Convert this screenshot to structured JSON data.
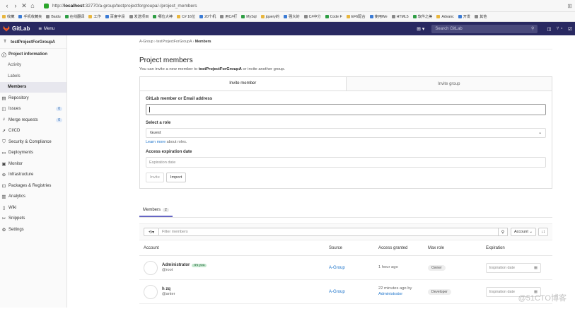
{
  "browser": {
    "url_prefix": "http://",
    "url_host": "localhost",
    "url_rest": ":32770/a-group/testprojectforgroupa/-/project_members",
    "bookmarks": [
      "收藏",
      "手机收藏夹",
      "Baidu",
      "在线翻译",
      "工作",
      "百度字段",
      "发送项目",
      "哪位大神",
      "C# 16位",
      "20个机",
      "用C#打",
      "MySql",
      "jquery的",
      "强大的",
      "C#中分",
      "Code F",
      "EF6配合",
      "使用We",
      "HTML5",
      "软件之美",
      "Advanc",
      "开发",
      "其他"
    ]
  },
  "header": {
    "brand": "GitLab",
    "menu_label": "Menu",
    "search_placeholder": "Search GitLab"
  },
  "sidebar": {
    "project_initial": "T",
    "project_name": "testProjectForGroupA",
    "items": [
      {
        "label": "Project information",
        "icon": "info-icon"
      },
      {
        "label": "Activity"
      },
      {
        "label": "Labels"
      },
      {
        "label": "Members"
      },
      {
        "label": "Repository",
        "icon": "doc-icon"
      },
      {
        "label": "Issues",
        "icon": "issues-icon",
        "count": "0"
      },
      {
        "label": "Merge requests",
        "icon": "merge-icon",
        "count": "0"
      },
      {
        "label": "CI/CD",
        "icon": "rocket-icon"
      },
      {
        "label": "Security & Compliance",
        "icon": "shield-icon"
      },
      {
        "label": "Deployments",
        "icon": "deploy-icon"
      },
      {
        "label": "Monitor",
        "icon": "monitor-icon"
      },
      {
        "label": "Infrastructure",
        "icon": "infra-icon"
      },
      {
        "label": "Packages & Registries",
        "icon": "package-icon"
      },
      {
        "label": "Analytics",
        "icon": "chart-icon"
      },
      {
        "label": "Wiki",
        "icon": "book-icon"
      },
      {
        "label": "Snippets",
        "icon": "scissors-icon"
      },
      {
        "label": "Settings",
        "icon": "gear-icon"
      }
    ]
  },
  "breadcrumb": [
    "A-Group",
    "testProjectForGroupA",
    "Members"
  ],
  "page": {
    "title": "Project members",
    "lead_prefix": "You can invite a new member to",
    "lead_project": "testProjectForGroupA",
    "lead_suffix": "or invite another group."
  },
  "invite": {
    "tab_member": "Invite member",
    "tab_group": "Invite group",
    "member_label": "GitLab member or Email address",
    "role_label": "Select a role",
    "role_value": "Guest",
    "learn_more": "Learn more",
    "about_roles": "about roles.",
    "expiration_label": "Access expiration date",
    "expiration_placeholder": "Expiration date",
    "invite_button": "Invite",
    "import_button": "Import"
  },
  "members": {
    "tab_label": "Members",
    "tab_count": "2",
    "filter_placeholder": "Filter members",
    "sort_label": "Account",
    "columns": [
      "Account",
      "Source",
      "Access granted",
      "Max role",
      "Expiration"
    ],
    "rows": [
      {
        "name": "Administrator",
        "badge": "It's you",
        "handle": "@root",
        "source": "A-Group",
        "granted": "1 hour ago",
        "granted_by": "",
        "role": "Owner",
        "expiration": "Expiration date"
      },
      {
        "name": "h zq",
        "badge": "",
        "handle": "@anter",
        "source": "A-Group",
        "granted": "22 minutes ago by",
        "granted_by": "Administrator",
        "role": "Developer",
        "expiration": "Expiration date"
      }
    ]
  },
  "watermark": "@51CTO博客"
}
